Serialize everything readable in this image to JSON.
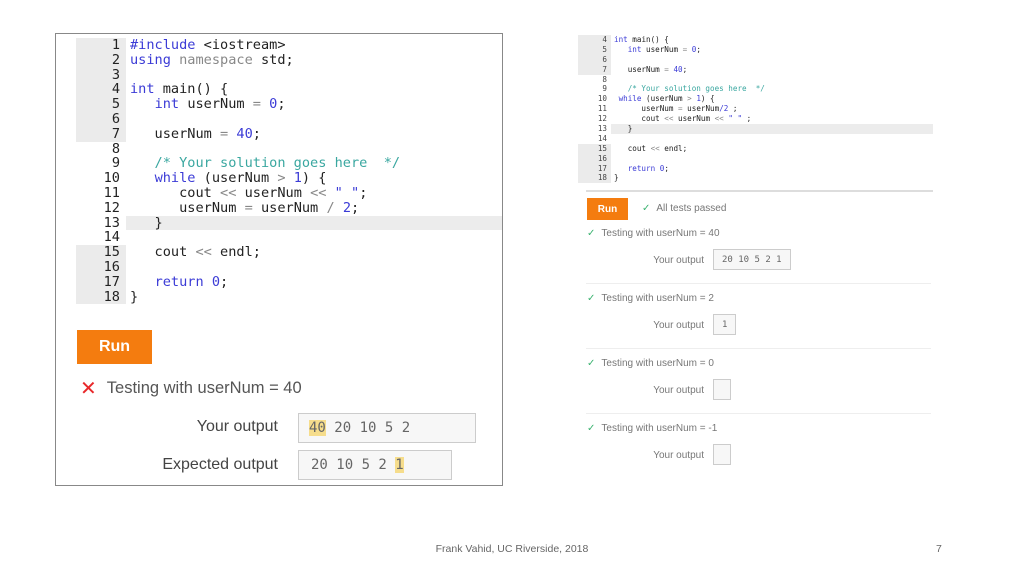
{
  "left": {
    "code": [
      {
        "n": "1",
        "g": true,
        "t": [
          [
            "kw",
            "#include "
          ],
          [
            "pl",
            "<iostream>"
          ]
        ]
      },
      {
        "n": "2",
        "g": true,
        "t": [
          [
            "kw",
            "using "
          ],
          [
            "op",
            "namespace "
          ],
          [
            "pl",
            "std;"
          ]
        ]
      },
      {
        "n": "3",
        "g": true,
        "t": []
      },
      {
        "n": "4",
        "g": true,
        "t": [
          [
            "kw",
            "int "
          ],
          [
            "pl",
            "main() {"
          ]
        ]
      },
      {
        "n": "5",
        "g": true,
        "t": [
          [
            "pl",
            "   "
          ],
          [
            "kw",
            "int "
          ],
          [
            "pl",
            "userNum "
          ],
          [
            "op",
            "= "
          ],
          [
            "num",
            "0"
          ],
          [
            "pl",
            ";"
          ]
        ]
      },
      {
        "n": "6",
        "g": true,
        "t": []
      },
      {
        "n": "7",
        "g": true,
        "t": [
          [
            "pl",
            "   userNum "
          ],
          [
            "op",
            "= "
          ],
          [
            "num",
            "40"
          ],
          [
            "pl",
            ";"
          ]
        ]
      },
      {
        "n": "8",
        "t": []
      },
      {
        "n": "9",
        "t": [
          [
            "cm",
            "   /* Your solution goes here  */"
          ]
        ]
      },
      {
        "n": "10",
        "t": [
          [
            "pl",
            "   "
          ],
          [
            "kw",
            "while "
          ],
          [
            "pl",
            "(userNum "
          ],
          [
            "op",
            "> "
          ],
          [
            "num",
            "1"
          ],
          [
            "pl",
            ") {"
          ]
        ]
      },
      {
        "n": "11",
        "t": [
          [
            "pl",
            "      cout "
          ],
          [
            "op",
            "<< "
          ],
          [
            "pl",
            "userNum "
          ],
          [
            "op",
            "<< "
          ],
          [
            "str",
            "\" \""
          ],
          [
            "pl",
            ";"
          ]
        ]
      },
      {
        "n": "12",
        "t": [
          [
            "pl",
            "      userNum "
          ],
          [
            "op",
            "= "
          ],
          [
            "pl",
            "userNum "
          ],
          [
            "op",
            "/ "
          ],
          [
            "num",
            "2"
          ],
          [
            "pl",
            ";"
          ]
        ]
      },
      {
        "n": "13",
        "h": true,
        "t": [
          [
            "pl",
            "   }"
          ]
        ]
      },
      {
        "n": "14",
        "t": []
      },
      {
        "n": "15",
        "g": true,
        "t": [
          [
            "pl",
            "   cout "
          ],
          [
            "op",
            "<< "
          ],
          [
            "pl",
            "endl;"
          ]
        ]
      },
      {
        "n": "16",
        "g": true,
        "t": []
      },
      {
        "n": "17",
        "g": true,
        "t": [
          [
            "pl",
            "   "
          ],
          [
            "kw",
            "return "
          ],
          [
            "num",
            "0"
          ],
          [
            "pl",
            ";"
          ]
        ]
      },
      {
        "n": "18",
        "g": true,
        "t": [
          [
            "pl",
            "}"
          ]
        ]
      }
    ],
    "run_label": "Run",
    "test_icon": "x-icon",
    "test_label": "Testing with userNum = 40",
    "your_output_label": "Your output",
    "your_output_highlight": "40",
    "your_output_rest": " 20 10 5 2",
    "expected_output_label": "Expected output",
    "expected_output_rest": "20 10 5 2 ",
    "expected_output_highlight": "1"
  },
  "right": {
    "code": [
      {
        "n": "4",
        "g": true,
        "t": [
          [
            "kw",
            "int "
          ],
          [
            "pl",
            "main() {"
          ]
        ]
      },
      {
        "n": "5",
        "g": true,
        "t": [
          [
            "pl",
            "   "
          ],
          [
            "kw",
            "int "
          ],
          [
            "pl",
            "userNum "
          ],
          [
            "op",
            "= "
          ],
          [
            "num",
            "0"
          ],
          [
            "pl",
            ";"
          ]
        ]
      },
      {
        "n": "6",
        "g": true,
        "t": []
      },
      {
        "n": "7",
        "g": true,
        "t": [
          [
            "pl",
            "   userNum "
          ],
          [
            "op",
            "= "
          ],
          [
            "num",
            "40"
          ],
          [
            "pl",
            ";"
          ]
        ]
      },
      {
        "n": "8",
        "t": []
      },
      {
        "n": "9",
        "t": [
          [
            "cm",
            "   /* Your solution goes here  */"
          ]
        ]
      },
      {
        "n": "10",
        "t": [
          [
            "pl",
            " "
          ],
          [
            "kw",
            "while "
          ],
          [
            "pl",
            "(userNum "
          ],
          [
            "op",
            "> "
          ],
          [
            "num",
            "1"
          ],
          [
            "pl",
            ") {"
          ]
        ]
      },
      {
        "n": "11",
        "t": [
          [
            "pl",
            "      userNum "
          ],
          [
            "op",
            "= "
          ],
          [
            "pl",
            "userNum"
          ],
          [
            "num",
            "/2"
          ],
          [
            "pl",
            " ;"
          ]
        ]
      },
      {
        "n": "12",
        "t": [
          [
            "pl",
            "      cout "
          ],
          [
            "op",
            "<< "
          ],
          [
            "pl",
            "userNum "
          ],
          [
            "op",
            "<< "
          ],
          [
            "str",
            "\" \""
          ],
          [
            "pl",
            " ;"
          ]
        ]
      },
      {
        "n": "13",
        "h": true,
        "t": [
          [
            "pl",
            "   }"
          ]
        ]
      },
      {
        "n": "14",
        "t": []
      },
      {
        "n": "15",
        "g": true,
        "t": [
          [
            "pl",
            "   cout "
          ],
          [
            "op",
            "<< "
          ],
          [
            "pl",
            "endl;"
          ]
        ]
      },
      {
        "n": "16",
        "g": true,
        "t": []
      },
      {
        "n": "17",
        "g": true,
        "t": [
          [
            "pl",
            "   "
          ],
          [
            "kw",
            "return "
          ],
          [
            "num",
            "0"
          ],
          [
            "pl",
            ";"
          ]
        ]
      },
      {
        "n": "18",
        "g": true,
        "t": [
          [
            "pl",
            "}"
          ]
        ]
      }
    ],
    "run_label": "Run",
    "status_label": "All tests passed",
    "tests": [
      {
        "label": "Testing with userNum = 40",
        "output_label": "Your output",
        "output": "20 10 5 2 1"
      },
      {
        "label": "Testing with userNum = 2",
        "output_label": "Your output",
        "output": "1"
      },
      {
        "label": "Testing with userNum = 0",
        "output_label": "Your output",
        "output": ""
      },
      {
        "label": "Testing with userNum = -1",
        "output_label": "Your output",
        "output": ""
      }
    ]
  },
  "footer": "Frank Vahid, UC Riverside, 2018",
  "page_number": "7",
  "colors": {
    "run_button": "#f47c0f",
    "fail": "#e8282a",
    "pass": "#3cb371",
    "highlight": "#f6dd8c",
    "keyword": "#3b3bd6",
    "comment": "#3aa7a0"
  }
}
